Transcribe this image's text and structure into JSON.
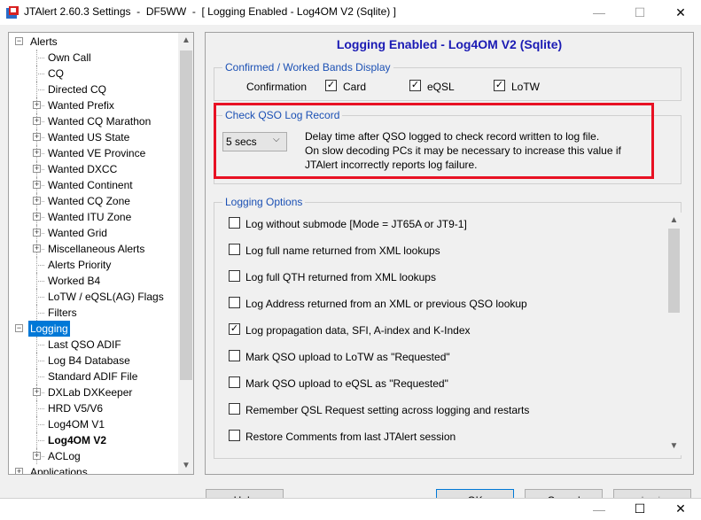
{
  "window": {
    "title": "JTAlert 2.60.3 Settings  -  DF5WW  -  [ Logging Enabled - Log4OM V2 (Sqlite) ]",
    "minimize": "—",
    "maximize": "☐",
    "close": "✕"
  },
  "tree": {
    "items": [
      {
        "label": "Alerts",
        "expander": "⊟",
        "level": 0
      },
      {
        "label": "Own Call",
        "level": 1
      },
      {
        "label": "CQ",
        "level": 1
      },
      {
        "label": "Directed CQ",
        "level": 1
      },
      {
        "label": "Wanted Prefix",
        "expander": "+",
        "level": 1
      },
      {
        "label": "Wanted CQ Marathon",
        "expander": "+",
        "level": 1
      },
      {
        "label": "Wanted US State",
        "expander": "+",
        "level": 1
      },
      {
        "label": "Wanted VE Province",
        "expander": "+",
        "level": 1
      },
      {
        "label": "Wanted DXCC",
        "expander": "+",
        "level": 1
      },
      {
        "label": "Wanted Continent",
        "expander": "+",
        "level": 1
      },
      {
        "label": "Wanted CQ Zone",
        "expander": "+",
        "level": 1
      },
      {
        "label": "Wanted ITU Zone",
        "expander": "+",
        "level": 1
      },
      {
        "label": "Wanted Grid",
        "expander": "+",
        "level": 1
      },
      {
        "label": "Miscellaneous Alerts",
        "expander": "+",
        "level": 1
      },
      {
        "label": "Alerts Priority",
        "level": 1
      },
      {
        "label": "Worked B4",
        "level": 1
      },
      {
        "label": "LoTW / eQSL(AG) Flags",
        "level": 1
      },
      {
        "label": "Filters",
        "level": 1
      },
      {
        "label": "Logging",
        "expander": "−",
        "level": 0,
        "selected": true
      },
      {
        "label": "Last QSO ADIF",
        "level": 1
      },
      {
        "label": "Log B4 Database",
        "level": 1
      },
      {
        "label": "Standard ADIF File",
        "level": 1
      },
      {
        "label": "DXLab DXKeeper",
        "expander": "+",
        "level": 1
      },
      {
        "label": "HRD V5/V6",
        "level": 1
      },
      {
        "label": "Log4OM V1",
        "level": 1
      },
      {
        "label": "Log4OM V2",
        "level": 1,
        "bold": true
      },
      {
        "label": "ACLog",
        "expander": "+",
        "level": 1
      },
      {
        "label": "Applications",
        "expander": "+",
        "level": 0
      }
    ]
  },
  "main": {
    "heading": "Logging Enabled - Log4OM V2 (Sqlite)",
    "bands_group": {
      "title": "Confirmed / Worked Bands Display",
      "confirmation_label": "Confirmation",
      "checkboxes": [
        {
          "label": "Card",
          "checked": true
        },
        {
          "label": "eQSL",
          "checked": true
        },
        {
          "label": "LoTW",
          "checked": true
        }
      ]
    },
    "check_group": {
      "title": "Check QSO Log Record",
      "delay_value": "5 secs",
      "description": [
        "Delay time after QSO logged to check record written to log file.",
        "On slow decoding PCs it may be necessary to increase this value if",
        "JTAlert incorrectly reports log failure."
      ]
    },
    "options_group": {
      "title": "Logging Options",
      "options": [
        {
          "label": "Log without submode [Mode = JT65A or JT9-1]",
          "checked": false
        },
        {
          "label": "Log full name returned from XML lookups",
          "checked": false
        },
        {
          "label": "Log full QTH returned from XML lookups",
          "checked": false
        },
        {
          "label": "Log Address returned from an XML or previous QSO lookup",
          "checked": false
        },
        {
          "label": "Log propagation data, SFI, A-index and K-Index",
          "checked": true
        },
        {
          "label": "Mark QSO upload to LoTW as \"Requested\"",
          "checked": false
        },
        {
          "label": "Mark QSO upload to eQSL as \"Requested\"",
          "checked": false
        },
        {
          "label": "Remember QSL Request setting across logging and restarts",
          "checked": false
        },
        {
          "label": "Restore Comments from last JTAlert session",
          "checked": false
        }
      ]
    }
  },
  "bottom": {
    "help": "Help",
    "ok": "OK",
    "cancel": "Cancel",
    "apply": "Apply"
  },
  "colors": {
    "selection": "#0078d7",
    "heading": "#1b1bb4",
    "group_title": "#1b50b4",
    "highlight_box": "#e81123"
  }
}
